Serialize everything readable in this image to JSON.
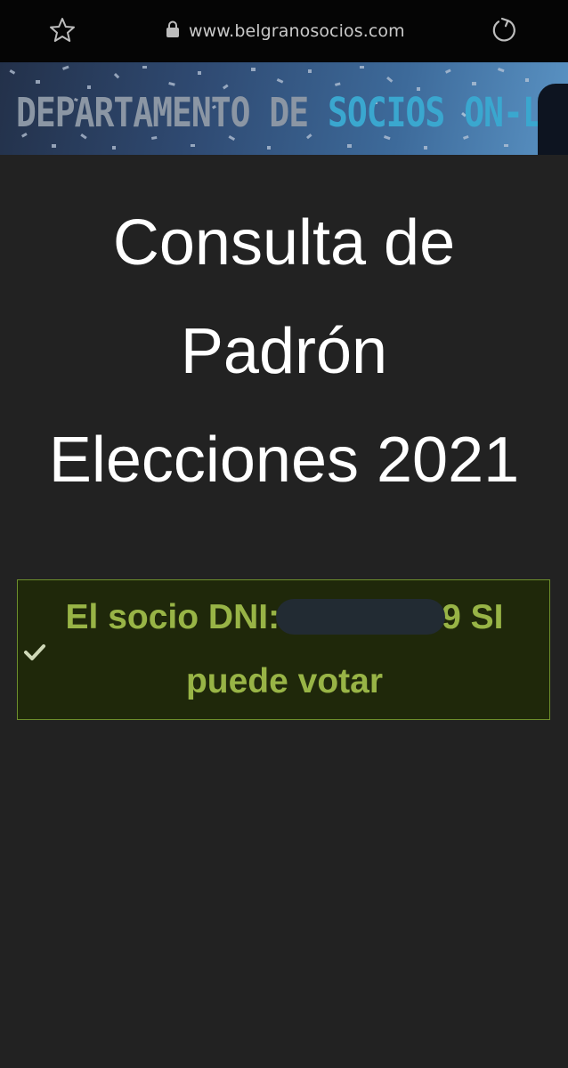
{
  "browser": {
    "url": "www.belgranosocios.com",
    "icons": [
      "star-icon",
      "lock-icon",
      "reload-icon"
    ]
  },
  "banner": {
    "text_part1": "DEPARTAMENTO DE ",
    "text_part2": "SOCIOS ON-LINE",
    "colors": {
      "part1": "#8b96a4",
      "part2": "#3aa7cf"
    }
  },
  "title": {
    "lines": [
      "Consulta de",
      "Padrón",
      "Elecciones 2021"
    ]
  },
  "alert": {
    "prefix": "El socio DNI:",
    "dni_visible_suffix": "9 SI",
    "second_line": "puede votar",
    "icon": "check-icon",
    "colors": {
      "text": "#98b446",
      "border": "#6e8e2c",
      "background": "#1f280a"
    }
  }
}
